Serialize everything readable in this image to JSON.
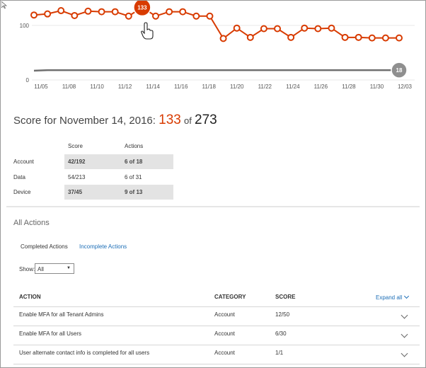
{
  "chart_data": {
    "type": "line",
    "x_ticks": [
      "11/05",
      "11/08",
      "11/10",
      "11/12",
      "11/14",
      "11/16",
      "11/18",
      "11/20",
      "11/22",
      "11/24",
      "11/26",
      "11/28",
      "11/30",
      "12/03"
    ],
    "y_ticks": [
      0,
      100
    ],
    "ylim": [
      0,
      140
    ],
    "grid": true,
    "series": [
      {
        "values": [
          119,
          121,
          127,
          118,
          126,
          125,
          125,
          117,
          133,
          117,
          125,
          125,
          117,
          117,
          76,
          95,
          78,
          94,
          94,
          78,
          95,
          94,
          95,
          78,
          78,
          77,
          77,
          77
        ],
        "color": "#d83b01",
        "highlight_label": "133"
      },
      {
        "values": [
          17,
          18,
          18,
          18,
          18,
          18,
          18,
          18,
          18,
          18,
          18,
          18,
          18,
          18,
          18,
          18,
          18,
          18,
          18,
          18,
          18,
          18,
          18,
          18,
          18,
          18,
          18,
          18
        ],
        "color": "#6f6f6f",
        "end_label": "18"
      }
    ]
  },
  "score": {
    "prefix": "Score for November 14, 2016:",
    "current": "133",
    "of": "of",
    "max": "273"
  },
  "breakdown": {
    "headers": {
      "score": "Score",
      "actions": "Actions"
    },
    "rows": [
      {
        "label": "Account",
        "score": "42/192",
        "actions": "6 of 18"
      },
      {
        "label": "Data",
        "score": "54/213",
        "actions": "6 of 31"
      },
      {
        "label": "Device",
        "score": "37/45",
        "actions": "9 of 13"
      }
    ]
  },
  "all_actions": {
    "title": "All Actions",
    "tabs": {
      "completed": "Completed Actions",
      "incomplete": "Incomplete Actions"
    },
    "show_label": "Show:",
    "show_value": "All"
  },
  "table": {
    "headers": {
      "action": "ACTION",
      "category": "CATEGORY",
      "score": "SCORE"
    },
    "expand_all": "Expand all",
    "rows": [
      {
        "action": "Enable MFA for all Tenant Admins",
        "category": "Account",
        "score": "12/50"
      },
      {
        "action": "Enable MFA for all Users",
        "category": "Account",
        "score": "6/30"
      },
      {
        "action": "User alternate contact info is completed for all users",
        "category": "Account",
        "score": "1/1"
      }
    ]
  },
  "colors": {
    "accent": "#d83b01",
    "link": "#1e6fb7",
    "device_line": "#6f6f6f"
  }
}
